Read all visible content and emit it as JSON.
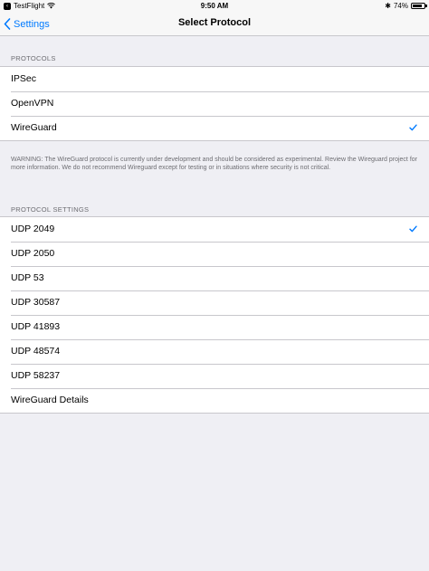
{
  "status_bar": {
    "app_back": "TestFlight",
    "time": "9:50 AM",
    "battery": "74%"
  },
  "nav": {
    "back_label": "Settings",
    "title": "Select Protocol"
  },
  "protocols": {
    "header": "PROTOCOLS",
    "items": [
      {
        "label": "IPSec",
        "selected": false
      },
      {
        "label": "OpenVPN",
        "selected": false
      },
      {
        "label": "WireGuard",
        "selected": true
      }
    ],
    "footer": "WARNING: The WireGuard protocol is currently under development and should be considered as experimental. Review the Wireguard project for more information. We do not recommend Wireguard except for testing or in situations where security is not critical."
  },
  "protocol_settings": {
    "header": "PROTOCOL SETTINGS",
    "items": [
      {
        "label": "UDP 2049",
        "selected": true
      },
      {
        "label": "UDP 2050",
        "selected": false
      },
      {
        "label": "UDP 53",
        "selected": false
      },
      {
        "label": "UDP 30587",
        "selected": false
      },
      {
        "label": "UDP 41893",
        "selected": false
      },
      {
        "label": "UDP 48574",
        "selected": false
      },
      {
        "label": "UDP 58237",
        "selected": false
      },
      {
        "label": "WireGuard Details",
        "selected": false
      }
    ]
  },
  "colors": {
    "accent": "#007aff",
    "background": "#efeff4",
    "separator": "#c8c7cc",
    "secondary_text": "#6d6d72"
  }
}
